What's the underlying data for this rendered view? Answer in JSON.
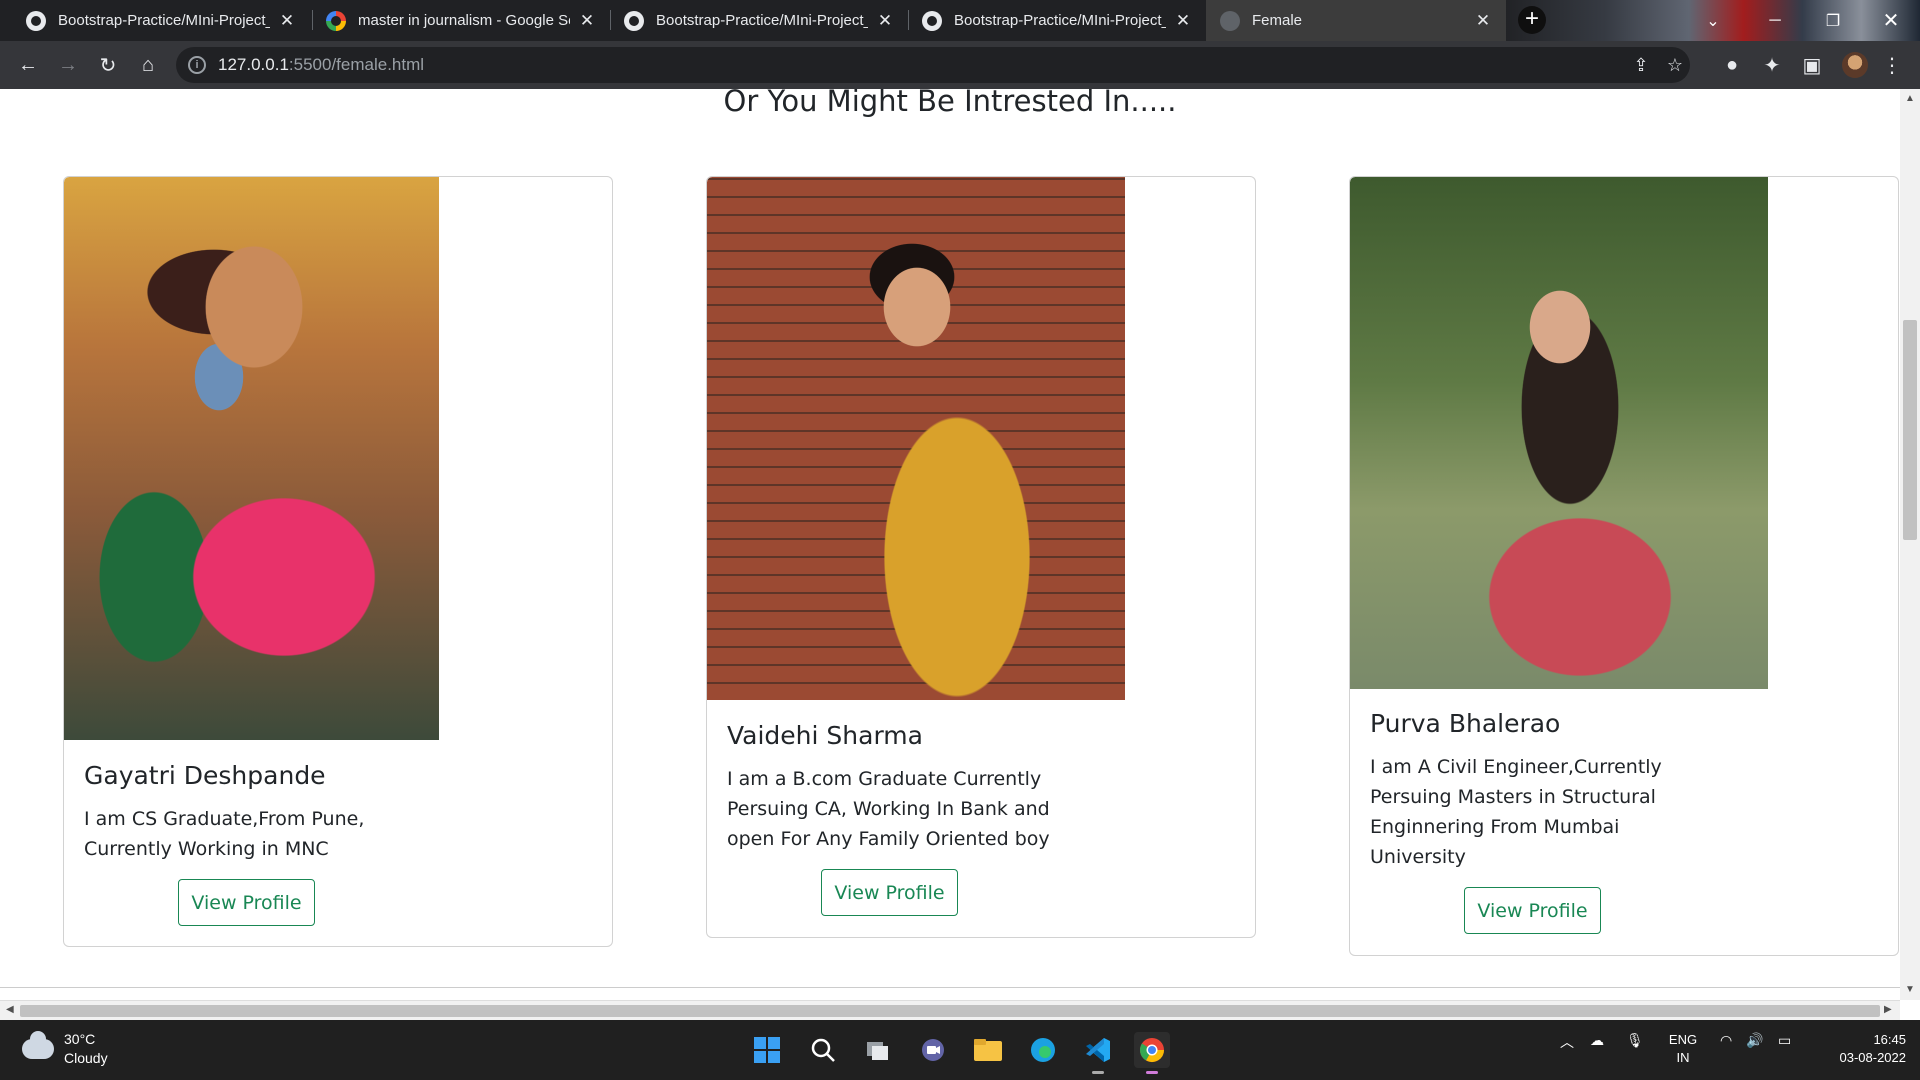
{
  "browser": {
    "tabs": [
      {
        "title": "Bootstrap-Practice/MIni-Project_",
        "icon": "github-icon",
        "active": false
      },
      {
        "title": "master in journalism - Google Se",
        "icon": "google-icon",
        "active": false
      },
      {
        "title": "Bootstrap-Practice/MIni-Project_",
        "icon": "github-icon",
        "active": false
      },
      {
        "title": "Bootstrap-Practice/MIni-Project_",
        "icon": "github-icon",
        "active": false
      },
      {
        "title": "Female",
        "icon": "globe-icon",
        "active": true
      }
    ],
    "url_host": "127.0.0.1",
    "url_path": ":5500/female.html"
  },
  "page": {
    "heading": "Or You Might Be Intrested In.....",
    "cards": [
      {
        "name": "Gayatri Deshpande",
        "desc_lines": [
          "I am CS Graduate,From Pune,",
          "Currently Working in MNC"
        ],
        "button": "View Profile"
      },
      {
        "name": "Vaidehi Sharma",
        "desc_lines": [
          "I am a B.com Graduate Currently",
          "Persuing CA, Working In Bank and",
          "open For Any Family Oriented boy"
        ],
        "button": "View Profile"
      },
      {
        "name": "Purva Bhalerao",
        "desc_lines": [
          "I am A Civil Engineer,Currently",
          "Persuing Masters in Structural",
          "Enginnering From Mumbai",
          "University"
        ],
        "button": "View Profile"
      }
    ],
    "accent_color": "#198754"
  },
  "taskbar": {
    "weather_temp": "30°C",
    "weather_desc": "Cloudy",
    "lang_top": "ENG",
    "lang_bottom": "IN",
    "time": "16:45",
    "date": "03-08-2022"
  }
}
